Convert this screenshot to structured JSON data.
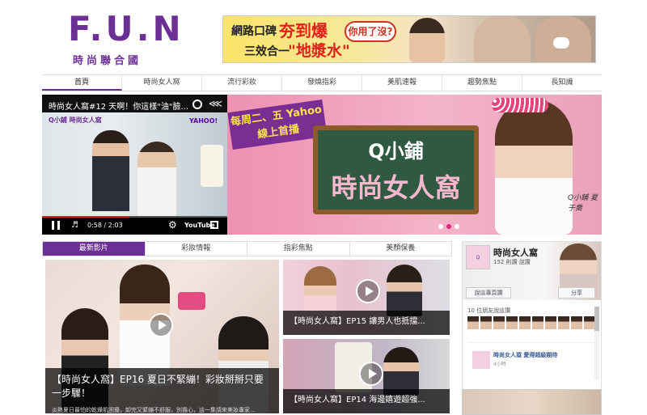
{
  "brand": {
    "logo_text": "F.U.N",
    "logo_sub": "時尚聯合國"
  },
  "top_ad": {
    "line1_prefix": "網路口碑",
    "line1_highlight": "夯到爆",
    "bubble": "你用了沒?",
    "line2_prefix": "三效合一",
    "line2_highlight": "\"地漿水\""
  },
  "nav": {
    "items": [
      "首頁",
      "時尚女人窩",
      "流行彩妝",
      "發燒指彩",
      "美肌速報",
      "趨勢焦點",
      "長知識"
    ],
    "active_index": 0
  },
  "hero": {
    "video_title": "時尚女人窩#12 天啊！你這樣\"油\"臉...",
    "video_logo": "Q小鋪 時尚女人窩",
    "yahoo_logo": "YAHOO!",
    "time": "0:58 / 2:03",
    "progress": 0.47,
    "youtube": "YouTube",
    "promo": "每周二、五 Yahoo線上首播",
    "board_line1": "Q小鋪",
    "board_line2": "時尚女人窩",
    "signature": "Q小鋪 夏于喬",
    "active_slide": 1,
    "slides": 3
  },
  "tabs": {
    "items": [
      "最新影片",
      "彩妝情報",
      "指彩焦點",
      "美顏保養"
    ],
    "active_index": 0
  },
  "videos": {
    "big": {
      "title": "【時尚女人窩】EP16 夏日不緊繃！彩妝掰掰只要一步驟！",
      "desc": "炎熱夏日最怕的乾燥肌困擾，卸完又緊繃不舒服，別擔心，這一集請來美妝專家..."
    },
    "small1": {
      "title": "【時尚女人窩】EP15 讓男人也抵擋..."
    },
    "small2": {
      "title": "【時尚女人窩】EP14 海邊嬉遊超強..."
    }
  },
  "facebook": {
    "page_name": "時尚女人窩",
    "likes_text": "152 則讚 說讚",
    "like_button": "說這專頁讚",
    "share_button": "分享",
    "friends_text": "10 位朋友說這讚",
    "post_name": "時尚女人窩 愛得超級期待",
    "post_time": "4小時"
  }
}
